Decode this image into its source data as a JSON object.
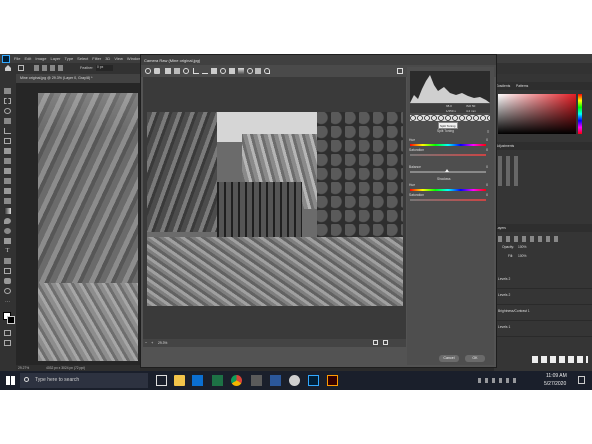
{
  "photoshop": {
    "menu": [
      "File",
      "Edit",
      "Image",
      "Layer",
      "Type",
      "Select",
      "Filter",
      "3D",
      "View",
      "Window",
      "Help"
    ],
    "options": {
      "feather_label": "Feather:",
      "feather_value": "0 px"
    },
    "doc_tab": "Mine original.jpg @ 29.3% (Layer 0, Gray/8) *",
    "status_zoom": "29.27%",
    "status_info": "4032 px x 3024 px (72 ppi)",
    "panels": {
      "tabs": [
        "Gradients",
        "Patterns"
      ],
      "adjustments_label": "Adjustments",
      "layers_label": "Layers",
      "opacity_label": "Opacity:",
      "opacity_value": "100%",
      "fill_label": "Fill:",
      "fill_value": "100%",
      "layers": [
        "Levels 2",
        "Levels 2",
        "Brightness/Contrast 1",
        "Levels 1"
      ]
    }
  },
  "camera_raw": {
    "title": "Camera Raw (Mine original.jpg)",
    "readout": {
      "r": "R:",
      "r_val": "---",
      "g": "G:",
      "g_val": "f/8.0",
      "b": "B:",
      "b_val": "ISO 50",
      "extra1": "1/250 s",
      "extra2": "4.2 mm"
    },
    "tooltip": "Split Toning",
    "section": "Split Toning",
    "highlights": {
      "hue_label": "Hue",
      "hue_val": "0",
      "sat_label": "Saturation",
      "sat_val": "0"
    },
    "balance": {
      "label": "Balance",
      "val": "0"
    },
    "shadows_label": "Shadows",
    "shadows": {
      "hue_label": "Hue",
      "hue_val": "0",
      "sat_label": "Saturation",
      "sat_val": "0"
    },
    "zoom": "29.3%",
    "cancel": "Cancel",
    "ok": "OK"
  },
  "taskbar": {
    "search_placeholder": "Type here to search",
    "time": "11:09 AM",
    "date": "5/27/2020"
  },
  "colors": {
    "accent": "#31a8ff",
    "taskbar": "#1a1f2b"
  }
}
